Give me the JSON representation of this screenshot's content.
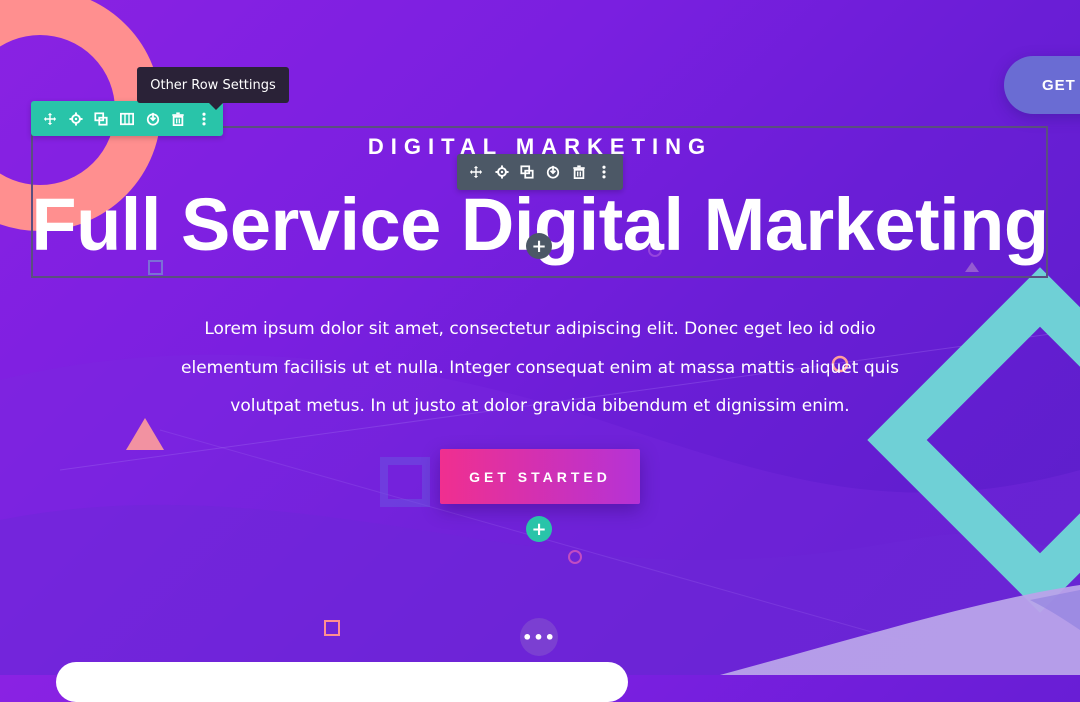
{
  "header": {
    "cta_label": "GET S"
  },
  "tooltip": {
    "text": "Other Row Settings"
  },
  "hero": {
    "eyebrow": "DIGITAL MARKETING",
    "headline": "Full Service Digital Marketing",
    "body": "Lorem ipsum dolor sit amet, consectetur adipiscing elit. Donec eget leo id odio elementum facilisis ut et nulla. Integer consequat enim at massa mattis aliquet quis volutpat metus. In ut justo at dolor gravida bibendum et dignissim enim.",
    "cta_label": "GET STARTED"
  },
  "builder": {
    "row_toolbar_icons": [
      "move-icon",
      "settings-icon",
      "duplicate-icon",
      "columns-icon",
      "save-icon",
      "delete-icon",
      "more-icon"
    ],
    "module_toolbar_icons": [
      "move-icon",
      "settings-icon",
      "duplicate-icon",
      "save-icon",
      "delete-icon",
      "more-icon"
    ],
    "add_symbol": "+",
    "more_symbol": "•••"
  },
  "colors": {
    "background_start": "#8a22e3",
    "background_end": "#5a1fc9",
    "row_toolbar": "#29c4a9",
    "module_toolbar": "#4c5866",
    "cta_start": "#f02f8f",
    "cta_end": "#b532d6",
    "accent_salmon": "#ff8f8f",
    "accent_teal": "#6fd0d6"
  }
}
